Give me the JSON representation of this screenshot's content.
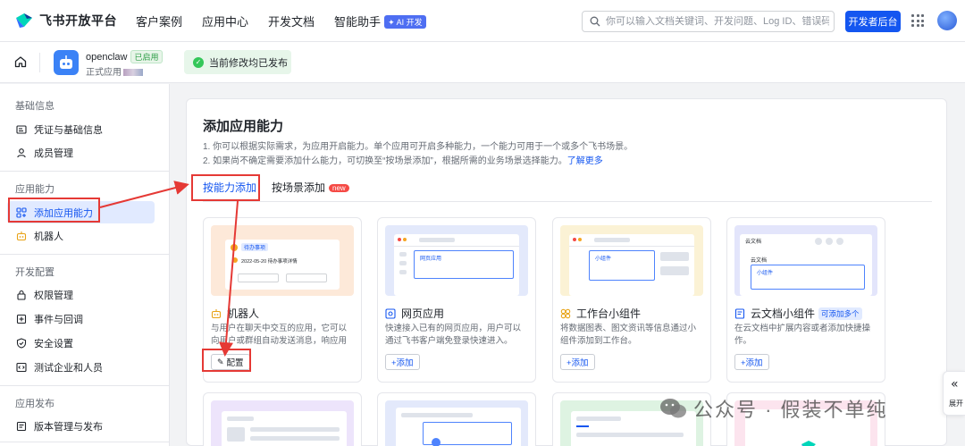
{
  "topnav": {
    "brand": "飞书开放平台",
    "links": [
      "客户案例",
      "应用中心",
      "开发文档",
      "智能助手"
    ],
    "ai_badge": "✦ AI 开发",
    "search_placeholder": "你可以输入文档关键词、开发问题、Log ID、错误码",
    "dev_console": "开发者后台"
  },
  "appbar": {
    "app_name": "openclaw",
    "app_status": "已启用",
    "app_type": "正式应用",
    "publish_status": "当前修改均已发布"
  },
  "sidebar": {
    "groups": {
      "basic": "基础信息",
      "capability": "应用能力",
      "dev": "开发配置",
      "release": "应用发布"
    },
    "items": {
      "credentials": "凭证与基础信息",
      "members": "成员管理",
      "add_capability": "添加应用能力",
      "bot": "机器人",
      "permissions": "权限管理",
      "events": "事件与回调",
      "security": "安全设置",
      "test_enterprise": "测试企业和人员",
      "version": "版本管理与发布"
    }
  },
  "main": {
    "title": "添加应用能力",
    "desc1": "1. 你可以根据实际需求，为应用开启能力。单个应用可开启多种能力，一个能力可用于一个或多个飞书场景。",
    "desc2": "2. 如果尚不确定需要添加什么能力，可切换至“按场景添加”，根据所需的业务场景选择能力。",
    "desc_link": "了解更多",
    "tabs": {
      "by_capability": "按能力添加",
      "by_scenario": "按场景添加",
      "new_badge": "new"
    },
    "cards": [
      {
        "title": "机器人",
        "desc": "与用户在聊天中交互的应用，它可以向用户或群组自动发送消息，响应用户的消...",
        "button": "配置"
      },
      {
        "title": "网页应用",
        "desc": "快速接入已有的网页应用，用户可以通过飞书客户端免登录快速进入。",
        "button": "+添加"
      },
      {
        "title": "工作台小组件",
        "desc": "将数据图表、图文资讯等信息通过小组件添加到工作台。",
        "button": "+添加"
      },
      {
        "title": "云文档小组件",
        "desc": "在云文档中扩展内容或者添加快捷操作。",
        "button": "+添加",
        "badge": "可添加多个"
      }
    ],
    "previews": {
      "bot_label": "待办事项",
      "bot_date": "2022-05-20 待办事项详情",
      "web_label": "网页应用",
      "widget_label": "小组件",
      "doc_title": "云文档",
      "doc_sub": "云文档",
      "doc_widget": "小组件"
    }
  },
  "watermark": "公众号 · 假装不单纯",
  "expand_label": "展开",
  "colors": {
    "primary": "#1456f0",
    "annotation": "#e53935",
    "success": "#34c759"
  }
}
